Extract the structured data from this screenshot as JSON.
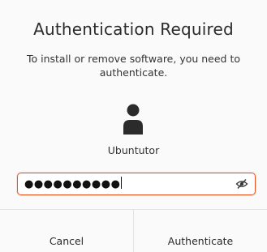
{
  "dialog": {
    "title": "Authentication Required",
    "message": "To install or remove software, you need to authenticate.",
    "user_name": "Ubuntutor",
    "password_mask": "●●●●●●●●●●",
    "cancel_label": "Cancel",
    "authenticate_label": "Authenticate",
    "accent_color": "#e95420",
    "reveal_icon": "eye-slash-icon",
    "avatar_icon": "user-avatar-icon"
  }
}
